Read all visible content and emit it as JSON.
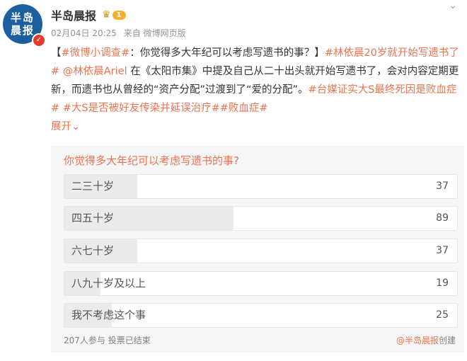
{
  "author": {
    "avatar_text": "半岛晨报",
    "name": "半岛晨报",
    "vip_level": "1"
  },
  "meta": {
    "datetime": "02月04日 20:25",
    "source": "来自 微博网页版"
  },
  "content": {
    "bracket_open": "【",
    "tag1": "#微博小调查#",
    "question": "：你觉得多大年纪可以考虑写遗书的事？】",
    "tag2": "#林依晨20岁就开始写遗书了#",
    "mention": "@林依晨Ariel",
    "body": " 在《太阳市集》中提及自己从二十出头就开始写遗书了，会对内容定期更新，而遗书也从曾经的“资产分配”过渡到了“爱的分配”。",
    "tag3": "#台媒证实大S最终死因是败血症#",
    "tag4": "#大S是否被好友传染并延误治疗#",
    "tag5": "#败血症#",
    "expand_label": "展开"
  },
  "poll": {
    "title": "你觉得多大年纪可以考虑写遗书的事?",
    "options": [
      {
        "label": "二三十岁",
        "count": "37",
        "share": 0.186
      },
      {
        "label": "四五十岁",
        "count": "89",
        "share": 0.43
      },
      {
        "label": "六七十岁",
        "count": "37",
        "share": 0.186
      },
      {
        "label": "八九十岁及以上",
        "count": "19",
        "share": 0.092
      },
      {
        "label": "我不考虑这个事",
        "count": "25",
        "share": 0.121
      }
    ],
    "participants": "207人参与",
    "status": "投票已结束",
    "creator_name": "@半岛晨报",
    "created_label": "创建"
  },
  "colors": {
    "accent": "#eb7350",
    "avatar_bg": "#1d5f9e",
    "verified": "#e23a2b",
    "vip": "#f2b230"
  }
}
